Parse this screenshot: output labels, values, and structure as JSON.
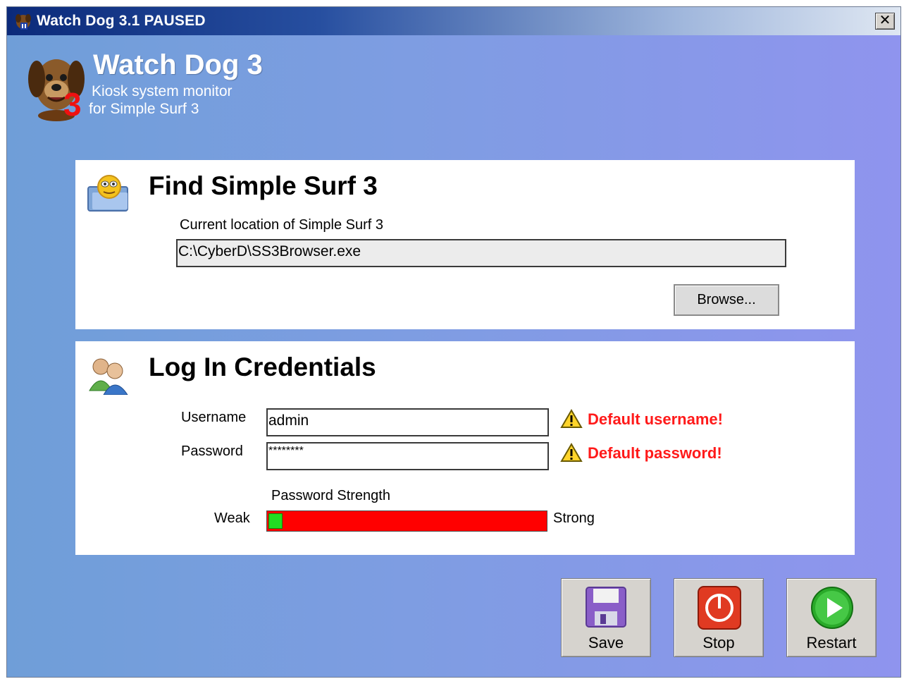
{
  "window": {
    "title": "Watch Dog 3.1 PAUSED",
    "close_label": "✕"
  },
  "header": {
    "app_name": "Watch Dog 3",
    "subtitle_line1": "Kiosk system monitor",
    "subtitle_line2": "for Simple Surf 3",
    "logo_badge": "3"
  },
  "find_section": {
    "title": "Find Simple Surf 3",
    "location_label": "Current location of Simple Surf 3",
    "location_value": "C:\\CyberD\\SS3Browser.exe",
    "browse_label": "Browse...",
    "icon": "folder-smiley-icon"
  },
  "credentials_section": {
    "title": "Log In Credentials",
    "icon": "users-icon",
    "username_label": "Username",
    "username_value": "admin",
    "password_label": "Password",
    "password_value": "********",
    "username_warning": "Default username!",
    "password_warning": "Default password!",
    "strength_title": "Password Strength",
    "strength_weak": "Weak",
    "strength_strong": "Strong",
    "strength_level": 0.05
  },
  "actions": {
    "save_label": "Save",
    "stop_label": "Stop",
    "restart_label": "Restart"
  },
  "colors": {
    "warning": "#ff1a1a",
    "strength_bar": "#ff0000",
    "strength_fill": "#22dd22"
  }
}
